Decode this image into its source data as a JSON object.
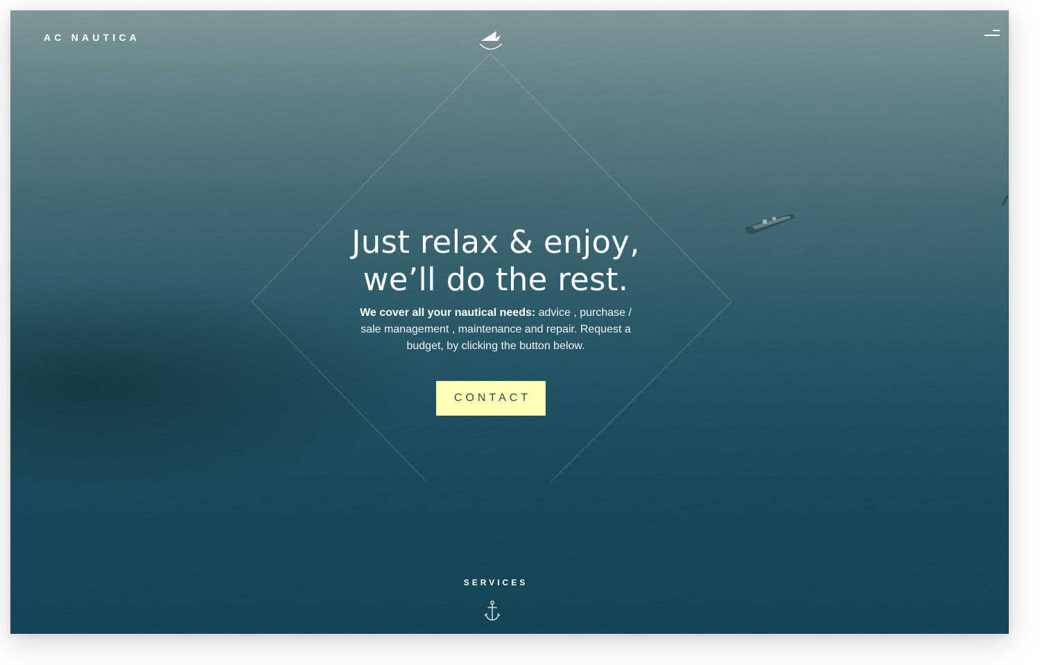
{
  "header": {
    "brand": "AC NAUTICA",
    "logo_icon": "sailboat-logo-icon",
    "menu_icon": "hamburger-menu-icon"
  },
  "hero": {
    "headline_line1": "Just relax & enjoy,",
    "headline_line2": "we’ll do the rest.",
    "description_bold": "We cover all your nautical needs:",
    "description_rest": " advice ,  purchase / sale management , maintenance and repair. Request a budget, by clicking the button below.",
    "cta_label": "CONTACT"
  },
  "footer": {
    "services_label": "SERVICES",
    "anchor_icon": "anchor-icon"
  },
  "colors": {
    "cta_background": "#ffffb5",
    "cta_text": "#2b4a52",
    "sea_top": "#7f9798",
    "sea_bottom": "#154455"
  }
}
